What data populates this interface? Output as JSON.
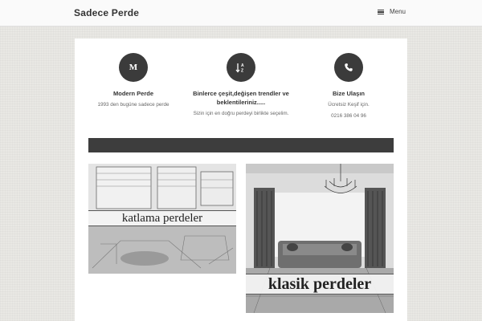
{
  "header": {
    "site_title": "Sadece Perde",
    "menu_label": "Menu"
  },
  "features": [
    {
      "icon": "m-letter-icon",
      "icon_text": "M",
      "title": "Modern Perde",
      "lines": [
        "1993 den bugüne sadece perde"
      ]
    },
    {
      "icon": "sort-az-icon",
      "title": "Binlerce çeşit,değişen trendler ve beklentileriniz.....",
      "lines": [
        "Sizin için en doğru perdeyi birlikte seçelim."
      ]
    },
    {
      "icon": "phone-icon",
      "title": "Bize Ulaşın",
      "lines": [
        "Ücretsiz Keşif için.",
        "0216 386 04 96"
      ]
    }
  ],
  "gallery": [
    {
      "caption": "katlama perdeler"
    },
    {
      "caption": "klasik perdeler"
    }
  ]
}
